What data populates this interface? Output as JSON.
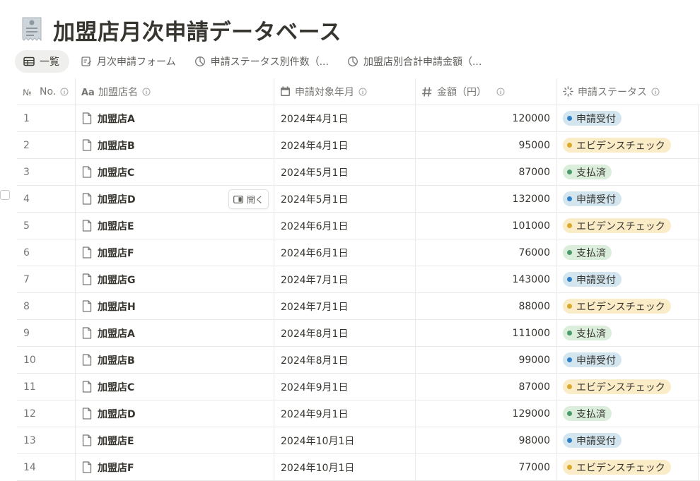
{
  "page": {
    "title": "加盟店月次申請データベース",
    "icon": "receipt-page-icon"
  },
  "tabs": [
    {
      "label": "一覧",
      "icon": "table-icon",
      "active": true
    },
    {
      "label": "月次申請フォーム",
      "icon": "form-icon",
      "active": false
    },
    {
      "label": "申請ステータス別件数（...",
      "icon": "pie-chart-icon",
      "active": false
    },
    {
      "label": "加盟店別合計申請金額（...",
      "icon": "pie-chart-icon",
      "active": false
    }
  ],
  "columns": [
    {
      "key": "no",
      "label": "No.",
      "icon": "number-sign-icon"
    },
    {
      "key": "name",
      "label": "加盟店名",
      "icon": "text-aa-icon"
    },
    {
      "key": "month",
      "label": "申請対象年月",
      "icon": "calendar-icon"
    },
    {
      "key": "amount",
      "label": "金額（円）",
      "icon": "hash-icon"
    },
    {
      "key": "status",
      "label": "申請ステータス",
      "icon": "status-spinner-icon"
    }
  ],
  "open_button_label": "開く",
  "status_colors": {
    "申請受付": {
      "bg": "#d3e5ef",
      "dot": "#2e7fc7"
    },
    "エビデンスチェック": {
      "bg": "#fbecc8",
      "dot": "#d9a82e"
    },
    "支払済": {
      "bg": "#dbeddb",
      "dot": "#4a9a6a"
    }
  },
  "rows": [
    {
      "no": "1",
      "name": "加盟店A",
      "month": "2024年4月1日",
      "amount": "120000",
      "status": "申請受付"
    },
    {
      "no": "2",
      "name": "加盟店B",
      "month": "2024年4月1日",
      "amount": "95000",
      "status": "エビデンスチェック"
    },
    {
      "no": "3",
      "name": "加盟店C",
      "month": "2024年5月1日",
      "amount": "87000",
      "status": "支払済"
    },
    {
      "no": "4",
      "name": "加盟店D",
      "month": "2024年5月1日",
      "amount": "132000",
      "status": "申請受付",
      "hover": true
    },
    {
      "no": "5",
      "name": "加盟店E",
      "month": "2024年6月1日",
      "amount": "101000",
      "status": "エビデンスチェック"
    },
    {
      "no": "6",
      "name": "加盟店F",
      "month": "2024年6月1日",
      "amount": "76000",
      "status": "支払済"
    },
    {
      "no": "7",
      "name": "加盟店G",
      "month": "2024年7月1日",
      "amount": "143000",
      "status": "申請受付"
    },
    {
      "no": "8",
      "name": "加盟店H",
      "month": "2024年7月1日",
      "amount": "88000",
      "status": "エビデンスチェック"
    },
    {
      "no": "9",
      "name": "加盟店A",
      "month": "2024年8月1日",
      "amount": "111000",
      "status": "支払済"
    },
    {
      "no": "10",
      "name": "加盟店B",
      "month": "2024年8月1日",
      "amount": "99000",
      "status": "申請受付"
    },
    {
      "no": "11",
      "name": "加盟店C",
      "month": "2024年9月1日",
      "amount": "87000",
      "status": "エビデンスチェック"
    },
    {
      "no": "12",
      "name": "加盟店D",
      "month": "2024年9月1日",
      "amount": "129000",
      "status": "支払済"
    },
    {
      "no": "13",
      "name": "加盟店E",
      "month": "2024年10月1日",
      "amount": "98000",
      "status": "申請受付"
    },
    {
      "no": "14",
      "name": "加盟店F",
      "month": "2024年10月1日",
      "amount": "77000",
      "status": "エビデンスチェック"
    }
  ]
}
